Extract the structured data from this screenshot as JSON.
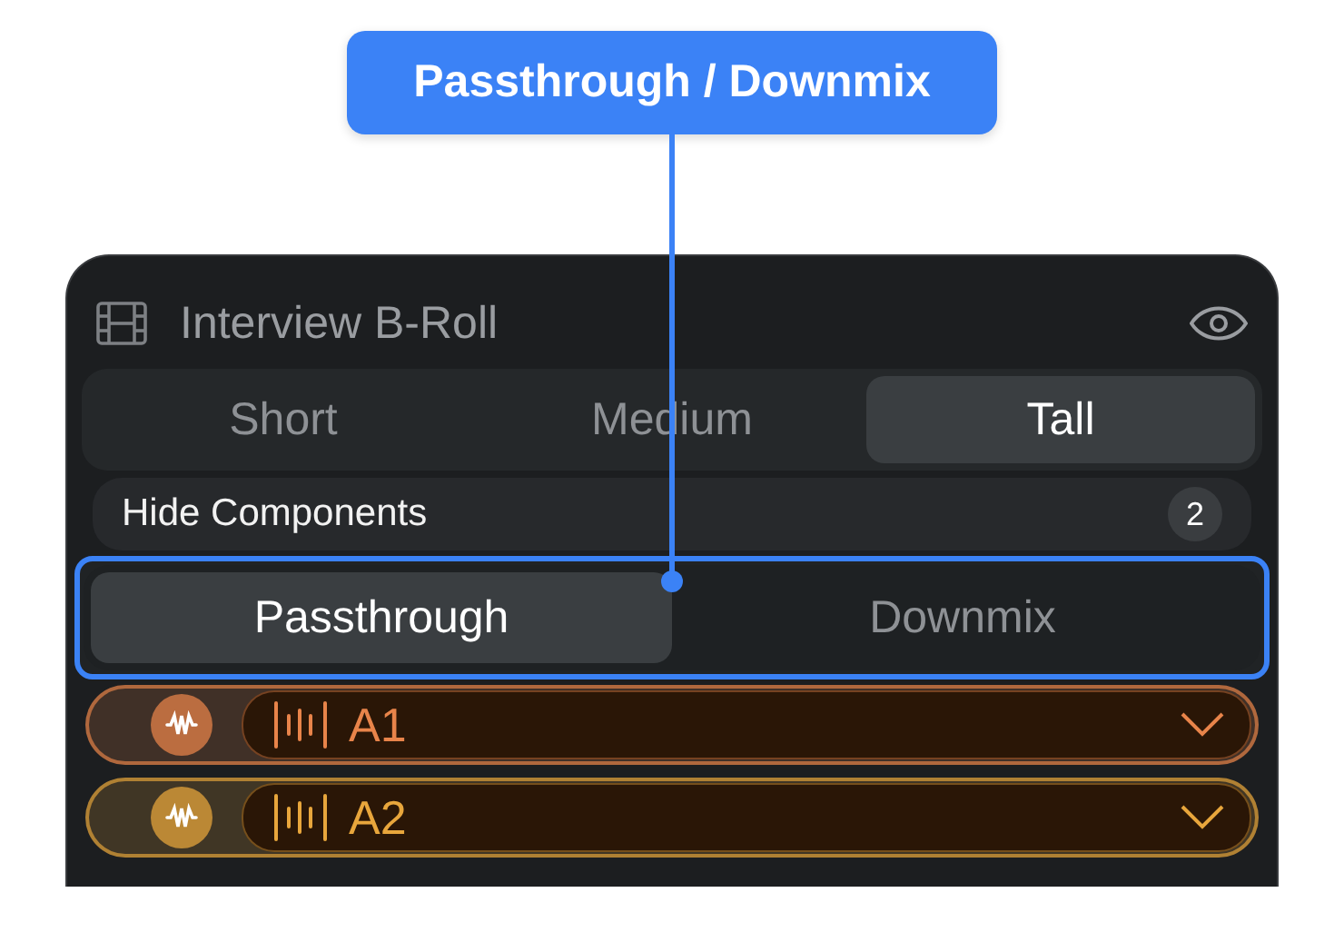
{
  "callout": {
    "label": "Passthrough / Downmix"
  },
  "panel": {
    "title": "Interview B-Roll",
    "size_tabs": [
      {
        "label": "Short",
        "selected": false
      },
      {
        "label": "Medium",
        "selected": false
      },
      {
        "label": "Tall",
        "selected": true
      }
    ],
    "hide_components": {
      "label": "Hide Components",
      "count": "2"
    },
    "mix_tabs": [
      {
        "label": "Passthrough",
        "selected": true
      },
      {
        "label": "Downmix",
        "selected": false
      }
    ],
    "tracks": [
      {
        "label": "A1",
        "color": "#e8844a"
      },
      {
        "label": "A2",
        "color": "#e8a63c"
      }
    ]
  }
}
